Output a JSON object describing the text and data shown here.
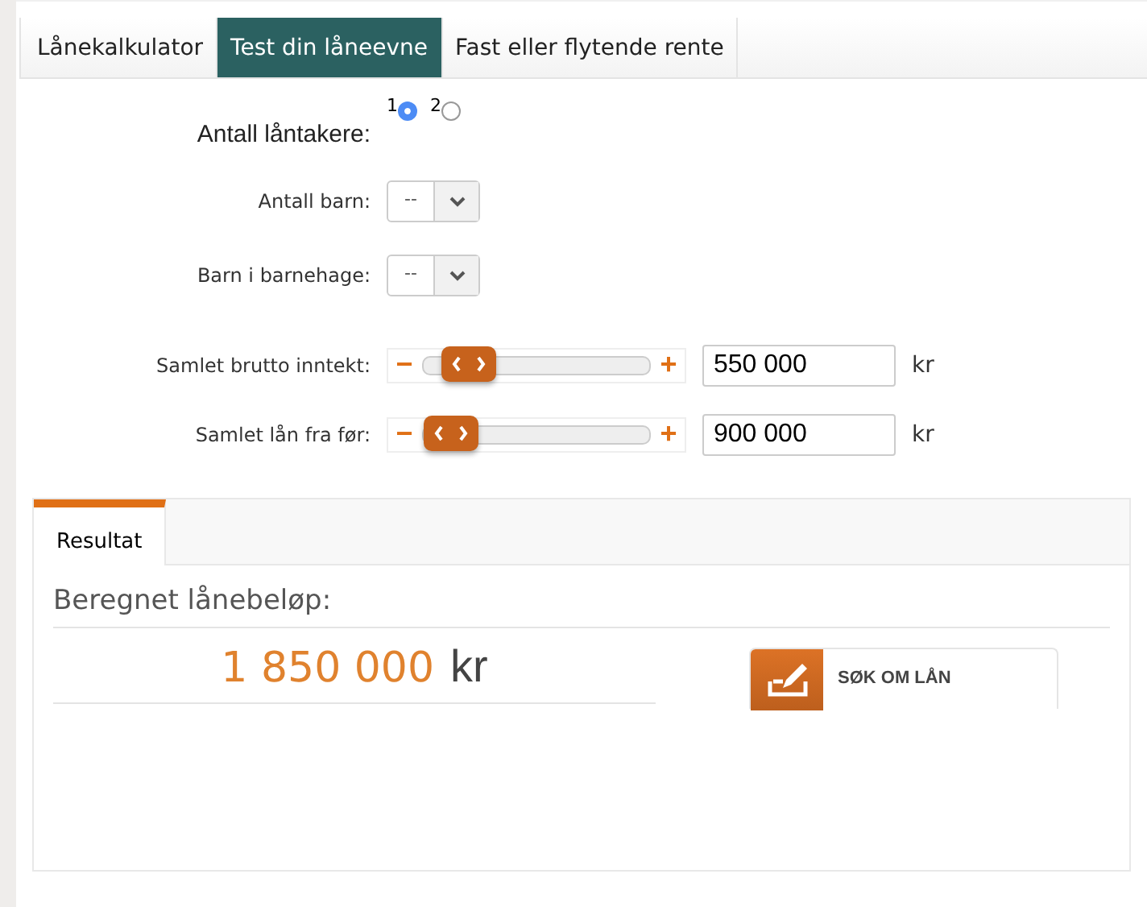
{
  "tabs": [
    {
      "label": "Lånekalkulator",
      "selected": false
    },
    {
      "label": "Test din låneevne",
      "selected": true
    },
    {
      "label": "Fast eller flytende rente",
      "selected": false
    }
  ],
  "borrowers": {
    "label": "Antall låntakere:",
    "options": [
      {
        "label": "1",
        "selected": true
      },
      {
        "label": "2",
        "selected": false
      }
    ]
  },
  "selects": [
    {
      "label": "Antall barn:",
      "value": "--"
    },
    {
      "label": "Barn i barnehage:",
      "value": "--"
    }
  ],
  "sliders": [
    {
      "label": "Samlet brutto inntekt:",
      "minus": "−",
      "plus": "+",
      "level": 0.1,
      "value": "550 000",
      "unit": "kr"
    },
    {
      "label": "Samlet lån fra før:",
      "minus": "−",
      "plus": "+",
      "level": 0.0,
      "value": "900 000",
      "unit": "kr"
    }
  ],
  "result": {
    "tab": "Resultat",
    "heading": "Beregnet lånebeløp:",
    "amount": "1 850 000",
    "unit": "kr",
    "button": "SØK OM LÅN"
  }
}
